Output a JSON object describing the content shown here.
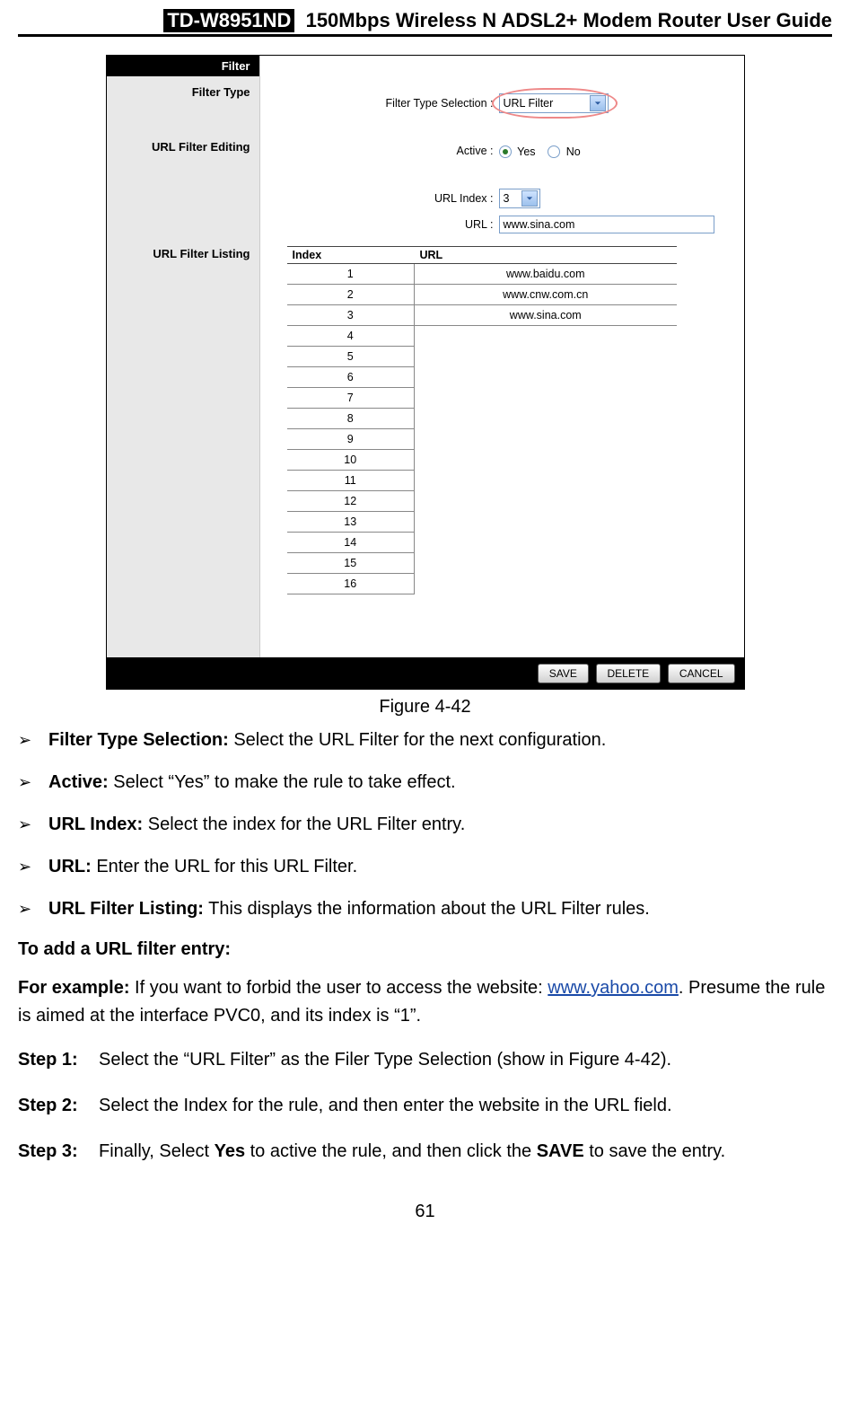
{
  "header": {
    "model": "TD-W8951ND",
    "title": "150Mbps Wireless N ADSL2+ Modem Router User Guide"
  },
  "screenshot": {
    "sidebar": {
      "title": "Filter",
      "section_filter_type": "Filter Type",
      "section_editing": "URL Filter Editing",
      "section_listing": "URL Filter Listing"
    },
    "form": {
      "filter_type_label": "Filter Type Selection :",
      "filter_type_value": "URL Filter",
      "active_label": "Active :",
      "active_yes": "Yes",
      "active_no": "No",
      "url_index_label": "URL Index :",
      "url_index_value": "3",
      "url_label": "URL :",
      "url_value": "www.sina.com"
    },
    "listing": {
      "col_index": "Index",
      "col_url": "URL",
      "rows": [
        {
          "index": "1",
          "url": "www.baidu.com"
        },
        {
          "index": "2",
          "url": "www.cnw.com.cn"
        },
        {
          "index": "3",
          "url": "www.sina.com"
        },
        {
          "index": "4",
          "url": ""
        },
        {
          "index": "5",
          "url": ""
        },
        {
          "index": "6",
          "url": ""
        },
        {
          "index": "7",
          "url": ""
        },
        {
          "index": "8",
          "url": ""
        },
        {
          "index": "9",
          "url": ""
        },
        {
          "index": "10",
          "url": ""
        },
        {
          "index": "11",
          "url": ""
        },
        {
          "index": "12",
          "url": ""
        },
        {
          "index": "13",
          "url": ""
        },
        {
          "index": "14",
          "url": ""
        },
        {
          "index": "15",
          "url": ""
        },
        {
          "index": "16",
          "url": ""
        }
      ]
    },
    "buttons": {
      "save": "SAVE",
      "delete": "DELETE",
      "cancel": "CANCEL"
    }
  },
  "caption": "Figure 4-42",
  "descriptions": [
    {
      "label": "Filter Type Selection:",
      "text": " Select the URL Filter for the next configuration."
    },
    {
      "label": "Active:",
      "text": " Select “Yes” to make the rule to take effect."
    },
    {
      "label": "URL Index:",
      "text": " Select the index for the URL Filter entry."
    },
    {
      "label": "URL:",
      "text": " Enter the URL for this URL Filter."
    },
    {
      "label": "URL Filter Listing:",
      "text": " This displays the information about the URL Filter rules."
    }
  ],
  "subhead_add": "To add a URL filter entry:",
  "example": {
    "lead": "For example:",
    "pre_link": " If you want to forbid the user to access the website: ",
    "link": "www.yahoo.com",
    "post_link": ". Presume the rule is aimed at the interface PVC0, and its index is “1”."
  },
  "steps": [
    {
      "label": "Step 1:",
      "text": "Select the “URL Filter” as the Filer Type Selection (show in Figure 4-42)."
    },
    {
      "label": "Step 2:",
      "text": "Select the Index for the rule, and then enter the website in the URL field."
    },
    {
      "label": "Step 3:",
      "pre": "Finally, Select ",
      "b1": "Yes",
      "mid": " to active the rule, and then click the ",
      "b2": "SAVE",
      "post": " to save the entry."
    }
  ],
  "page_number": "61"
}
